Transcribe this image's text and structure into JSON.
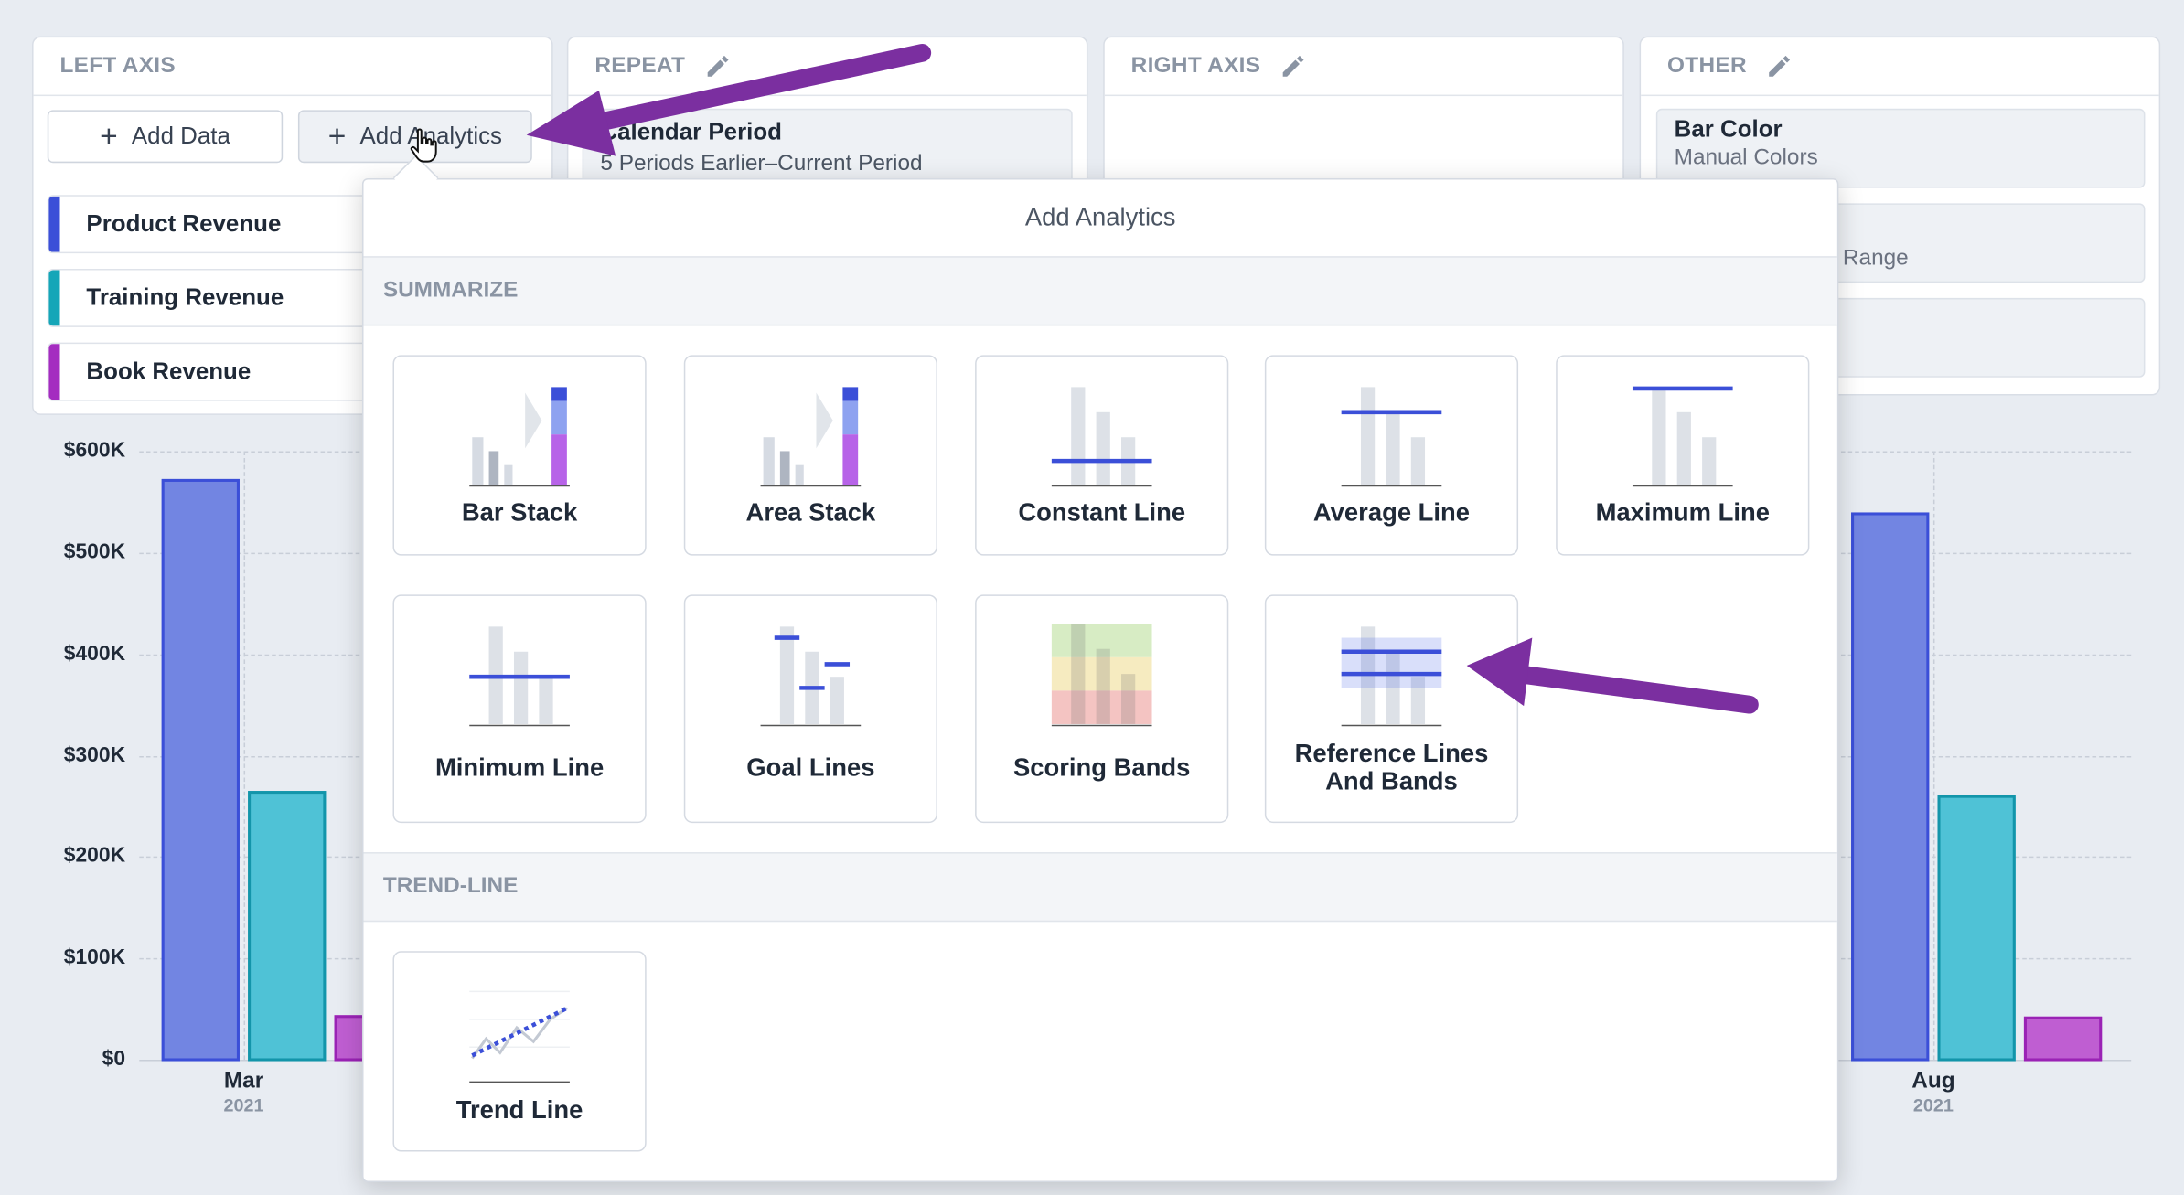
{
  "panels": {
    "left_axis": {
      "title": "LEFT AXIS",
      "add_data": "Add Data",
      "add_analytics": "Add Analytics"
    },
    "repeat": {
      "title": "REPEAT",
      "field_title": "Calendar Period",
      "field_value": "5 Periods Earlier–Current Period"
    },
    "right_axis": {
      "title": "RIGHT AXIS"
    },
    "other": {
      "title": "OTHER",
      "field1_title": "Bar Color",
      "field1_value": "Manual Colors",
      "field2_value": "Range"
    }
  },
  "series": [
    {
      "name": "Product Revenue",
      "color": "#3b4fd8"
    },
    {
      "name": "Training Revenue",
      "color": "#15a6b8"
    },
    {
      "name": "Book Revenue",
      "color": "#a42cc0"
    }
  ],
  "chart_data": {
    "type": "bar",
    "yticks": [
      "$600K",
      "$500K",
      "$400K",
      "$300K",
      "$200K",
      "$100K",
      "$0"
    ],
    "ylim": [
      0,
      600000
    ],
    "categories": [
      {
        "month": "Mar",
        "year": "2021"
      },
      {
        "month": "Aug",
        "year": "2021"
      }
    ],
    "series": [
      {
        "name": "Product Revenue",
        "values": [
          573000,
          540000
        ],
        "fill": "#7285e2",
        "stroke": "#3b4fd8"
      },
      {
        "name": "Training Revenue",
        "values": [
          265000,
          261000
        ],
        "fill": "#4fc2d6",
        "stroke": "#1395aa"
      },
      {
        "name": "Book Revenue",
        "values": [
          44000,
          43000
        ],
        "fill": "#bf5ed2",
        "stroke": "#9a23b5"
      }
    ]
  },
  "popover": {
    "title": "Add Analytics",
    "summarize_heading": "SUMMARIZE",
    "trend_heading": "TREND-LINE",
    "tiles": {
      "bar_stack": "Bar Stack",
      "area_stack": "Area Stack",
      "constant_line": "Constant Line",
      "average_line": "Average Line",
      "maximum_line": "Maximum Line",
      "minimum_line": "Minimum Line",
      "goal_lines": "Goal Lines",
      "scoring_bands": "Scoring Bands",
      "reference_lines_1": "Reference Lines",
      "reference_lines_2": "And Bands",
      "trend_line": "Trend Line"
    }
  },
  "colors": {
    "accent": "#3b4fd8",
    "arrow": "#7b2fa0",
    "background": "#e8ecf2"
  }
}
